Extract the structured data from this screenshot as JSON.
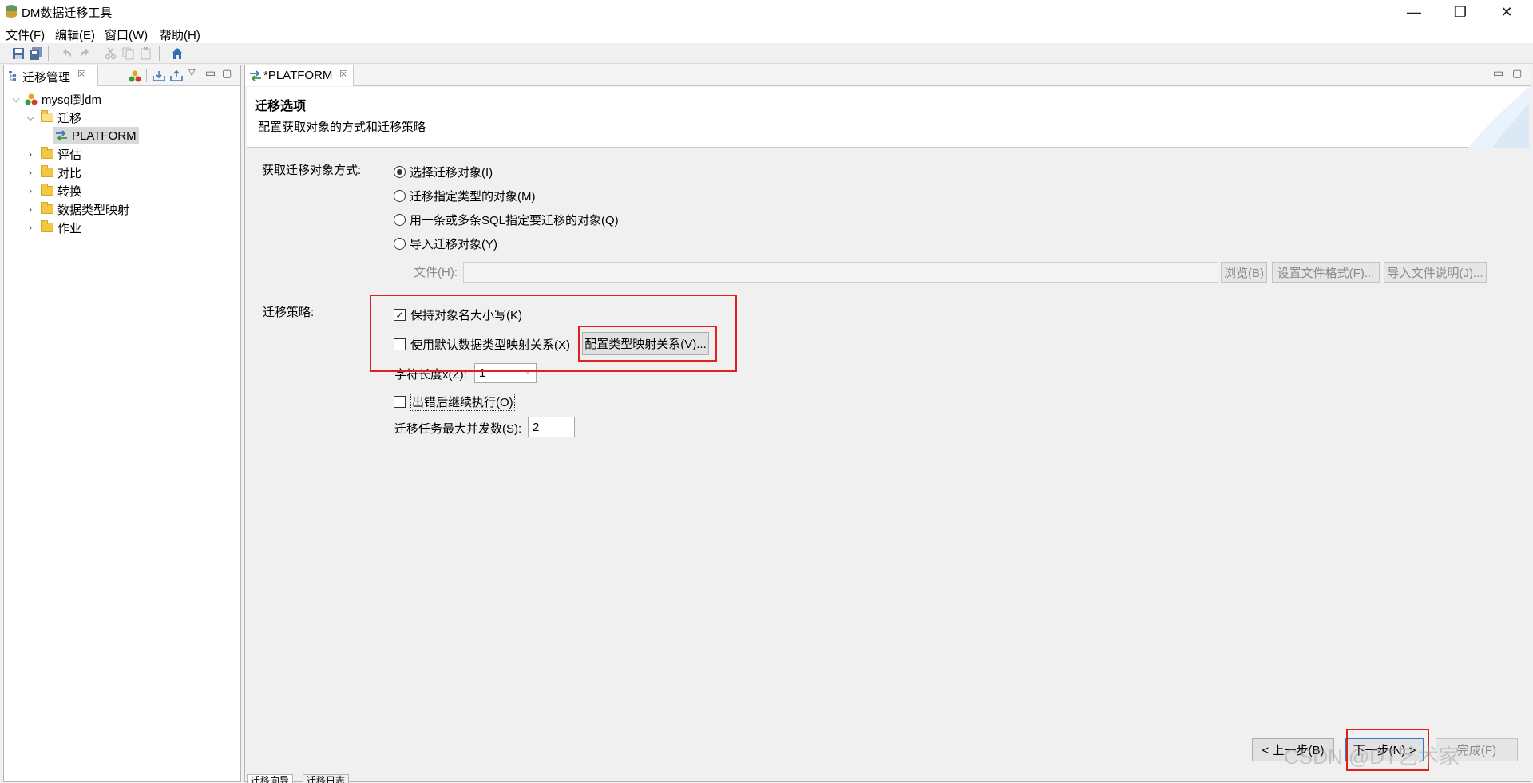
{
  "window": {
    "title": "DM数据迁移工具",
    "controls": {
      "minimize": "—",
      "restore": "❐",
      "close": "✕"
    }
  },
  "menu": [
    {
      "label": "文件(F)"
    },
    {
      "label": "编辑(E)"
    },
    {
      "label": "窗口(W)"
    },
    {
      "label": "帮助(H)"
    }
  ],
  "toolbar": {
    "icons": [
      "save-icon",
      "save-all-icon",
      "undo-icon",
      "redo-icon",
      "cut-icon",
      "copy-icon",
      "paste-icon",
      "home-icon"
    ]
  },
  "left_view": {
    "tab_label": "迁移管理",
    "tree": {
      "root": "mysql到dm",
      "migration_folder": "迁移",
      "migration_item": "PLATFORM",
      "folders": [
        "评估",
        "对比",
        "转换",
        "数据类型映射",
        "作业"
      ]
    }
  },
  "editor": {
    "tab_label": "*PLATFORM",
    "wizard_title": "迁移选项",
    "wizard_desc": "配置获取对象的方式和迁移策略",
    "fetch_label": "获取迁移对象方式:",
    "fetch_options": [
      {
        "label": "选择迁移对象(I)",
        "selected": true
      },
      {
        "label": "迁移指定类型的对象(M)",
        "selected": false
      },
      {
        "label": "用一条或多条SQL指定要迁移的对象(Q)",
        "selected": false
      },
      {
        "label": "导入迁移对象(Y)",
        "selected": false
      }
    ],
    "file": {
      "label": "文件(H):",
      "value": "",
      "browse_button": "浏览(B)",
      "format_button": "设置文件格式(F)...",
      "readme_button": "导入文件说明(J)..."
    },
    "strategy_label": "迁移策略:",
    "keep_case": {
      "label": "保持对象名大小写(K)",
      "checked": true,
      "mark": "✓"
    },
    "default_mapping": {
      "label": "使用默认数据类型映射关系(X)",
      "checked": false
    },
    "config_mapping_button": "配置类型映射关系(V)...",
    "char_length": {
      "label": "字符长度x(Z):",
      "value": "1"
    },
    "continue_on_error": {
      "label": "出错后继续执行(O)",
      "checked": false
    },
    "max_concurrency": {
      "label": "迁移任务最大并发数(S):",
      "value": "2"
    }
  },
  "footer": {
    "back_button": "< 上一步(B)",
    "next_button": "下一步(N) >",
    "finish_button": "完成(F)"
  },
  "bottom_tabs": [
    "迁移向导",
    "迁移日志"
  ],
  "watermark": "CSDN @DT艺术家",
  "colors": {
    "highlight_box": "#e0201c",
    "selection": "#d9d9d9",
    "folder": "#f2c744"
  }
}
